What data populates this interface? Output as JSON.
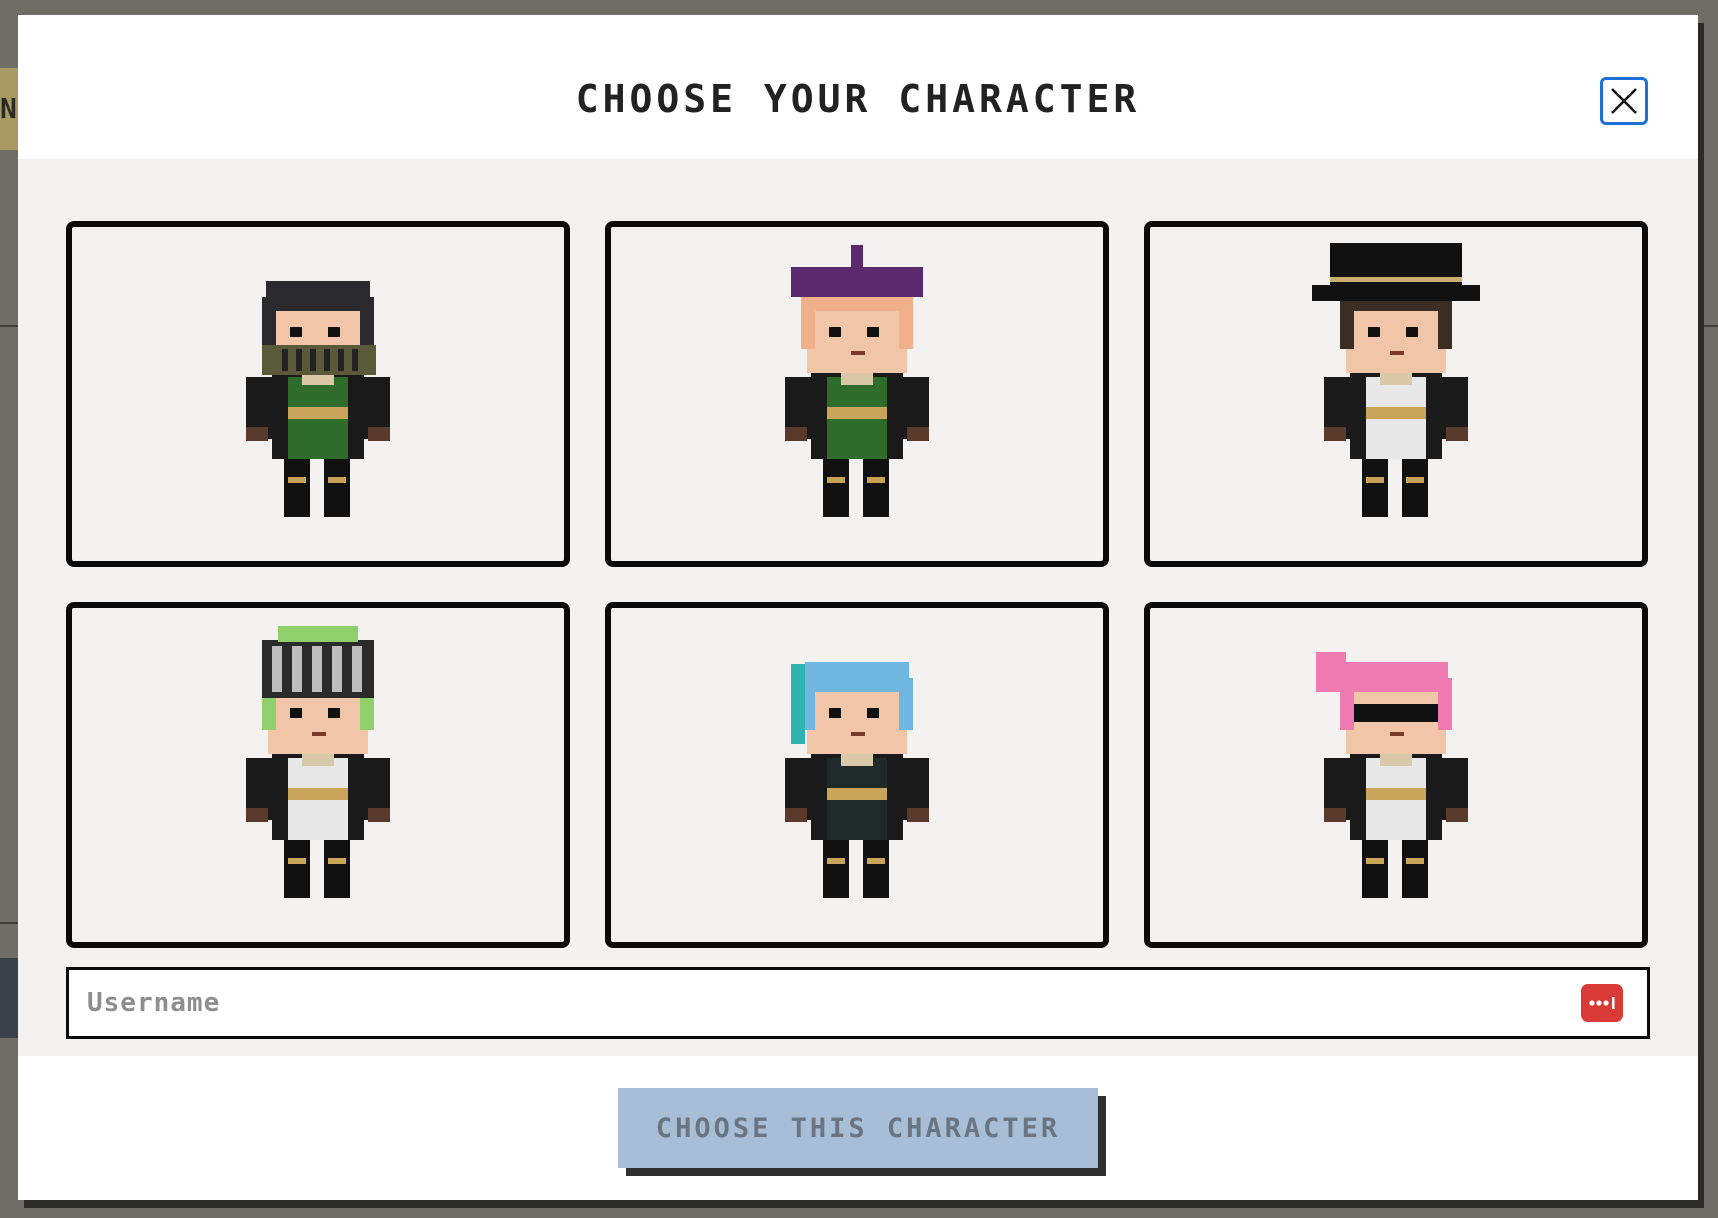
{
  "modal": {
    "title": "CHOOSE YOUR CHARACTER",
    "close_icon": "close-icon"
  },
  "characters": [
    {
      "id": 1,
      "hair": "#2a2a2e",
      "accent": "#5a5a3a",
      "outfit": "#2f6b2a",
      "feature": "mask"
    },
    {
      "id": 2,
      "hair": "#f0b08a",
      "accent": "#5b2a6e",
      "outfit": "#2f6b2a",
      "feature": "beret"
    },
    {
      "id": 3,
      "hair": "#3a2e24",
      "accent": "#111111",
      "outfit": "#e8e8e8",
      "feature": "pirate-hat"
    },
    {
      "id": 4,
      "hair": "#8fd06a",
      "accent": "#4a4a4a",
      "outfit": "#e8e8e8",
      "feature": "visor-helmet"
    },
    {
      "id": 5,
      "hair": "#6fb6e0",
      "accent": "#2fb3b3",
      "outfit": "#1f2a2a",
      "feature": "hair"
    },
    {
      "id": 6,
      "hair": "#f07ab2",
      "accent": "#111111",
      "outfit": "#e8e8e8",
      "feature": "sunglasses"
    }
  ],
  "username": {
    "placeholder": "Username",
    "value": "",
    "password_manager_icon": "password-manager-icon"
  },
  "footer": {
    "choose_label": "CHOOSE THIS CHARACTER"
  },
  "colors": {
    "overlay": "#6e6d66",
    "panel": "#f3f2f0",
    "card_border": "#0b0b0b",
    "close_border": "#1f6fd8",
    "button_bg": "#a8bed6",
    "button_text": "#6a7584",
    "badge": "#d93a35"
  }
}
